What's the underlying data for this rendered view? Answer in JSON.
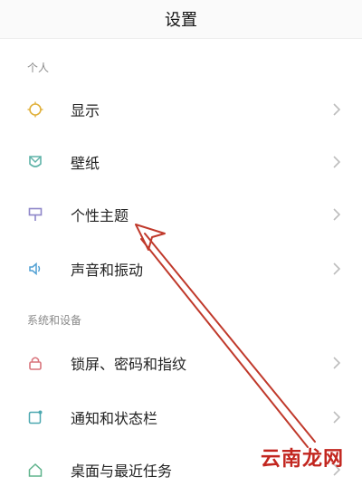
{
  "header": {
    "title": "设置"
  },
  "sections": [
    {
      "label": "个人",
      "items": [
        {
          "label": "显示",
          "icon": "brightness-icon"
        },
        {
          "label": "壁纸",
          "icon": "wallpaper-icon"
        },
        {
          "label": "个性主题",
          "icon": "theme-brush-icon"
        },
        {
          "label": "声音和振动",
          "icon": "speaker-icon"
        }
      ]
    },
    {
      "label": "系统和设备",
      "items": [
        {
          "label": "锁屏、密码和指纹",
          "icon": "lock-icon"
        },
        {
          "label": "通知和状态栏",
          "icon": "notification-icon"
        },
        {
          "label": "桌面与最近任务",
          "icon": "home-icon"
        }
      ]
    }
  ],
  "watermark": "云南龙网",
  "colors": {
    "icon_tint": "#7fa7a3",
    "annotation_arrow": "#c0392b"
  }
}
